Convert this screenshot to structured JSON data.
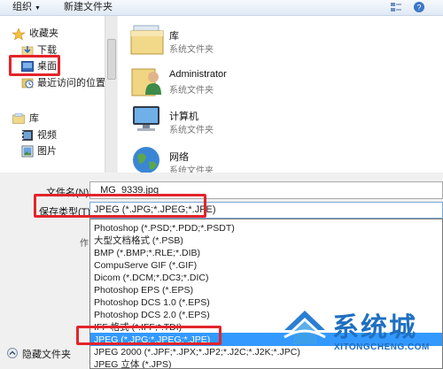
{
  "toolbar": {
    "organize": "组织",
    "new_folder": "新建文件夹"
  },
  "nav": {
    "favorites": "收藏夹",
    "downloads": "下载",
    "desktop": "桌面",
    "recent": "最近访问的位置",
    "libraries": "库",
    "videos": "视频",
    "pictures": "图片",
    "documents": "文档"
  },
  "content": {
    "items": [
      {
        "name": "库",
        "type": "系统文件夹"
      },
      {
        "name": "Administrator",
        "type": "系统文件夹"
      },
      {
        "name": "计算机",
        "type": "系统文件夹"
      },
      {
        "name": "网络",
        "type": "系统文件夹"
      }
    ]
  },
  "form": {
    "filename_label": "文件名(N):",
    "filename_value": "_MG_9339.jpg",
    "type_label": "保存类型(T):",
    "type_value": "JPEG (*.JPG;*.JPEG;*.JPE)",
    "side_label": "作"
  },
  "dropdown": {
    "options": [
      "Photoshop (*.PSD;*.PDD;*.PSDT)",
      "大型文档格式 (*.PSB)",
      "BMP (*.BMP;*.RLE;*.DIB)",
      "CompuServe GIF (*.GIF)",
      "Dicom (*.DCM;*.DC3;*.DIC)",
      "Photoshop EPS (*.EPS)",
      "Photoshop DCS 1.0 (*.EPS)",
      "Photoshop DCS 2.0 (*.EPS)",
      "IFF 格式 (*.IFF;*.TDI)",
      "JPEG (*.JPG;*.JPEG;*.JPE)",
      "JPEG 2000 (*.JPF;*.JPX;*.JP2;*.J2C;*.J2K;*.JPC)",
      "JPEG 立体 (*.JPS)"
    ],
    "selected": "JPEG (*.JPG;*.JPEG;*.JPE)"
  },
  "footer": {
    "hide_folders": "隐藏文件夹"
  },
  "watermark": {
    "brand": "系统城",
    "url": "XITONGCHENG.COM"
  },
  "colors": {
    "highlight": "#3399ff",
    "annotation": "#e3242b"
  }
}
